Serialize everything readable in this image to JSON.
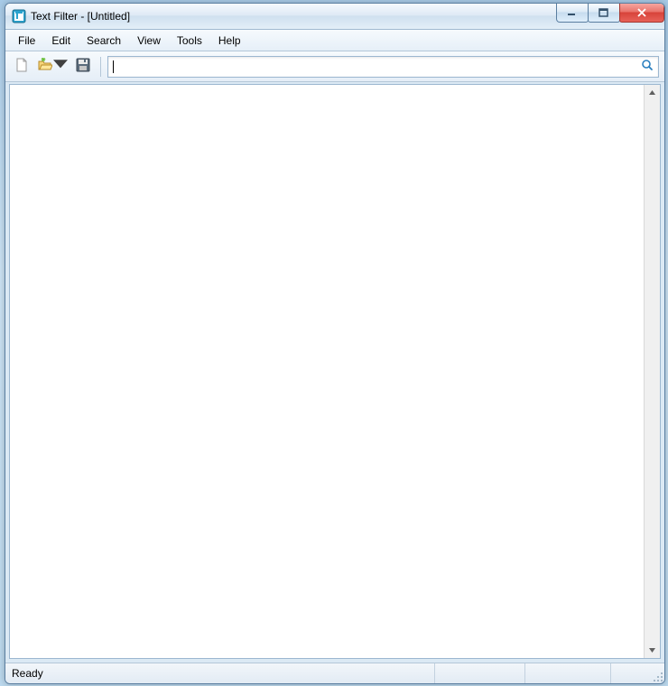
{
  "window": {
    "title": "Text Filter - [Untitled]"
  },
  "menu": {
    "items": [
      "File",
      "Edit",
      "Search",
      "View",
      "Tools",
      "Help"
    ]
  },
  "toolbar": {
    "new_name": "new-file-icon",
    "open_name": "open-folder-icon",
    "save_name": "save-disk-icon",
    "search_name": "search-icon"
  },
  "search": {
    "value": "",
    "placeholder": ""
  },
  "content": {
    "text": ""
  },
  "status": {
    "text": "Ready"
  }
}
